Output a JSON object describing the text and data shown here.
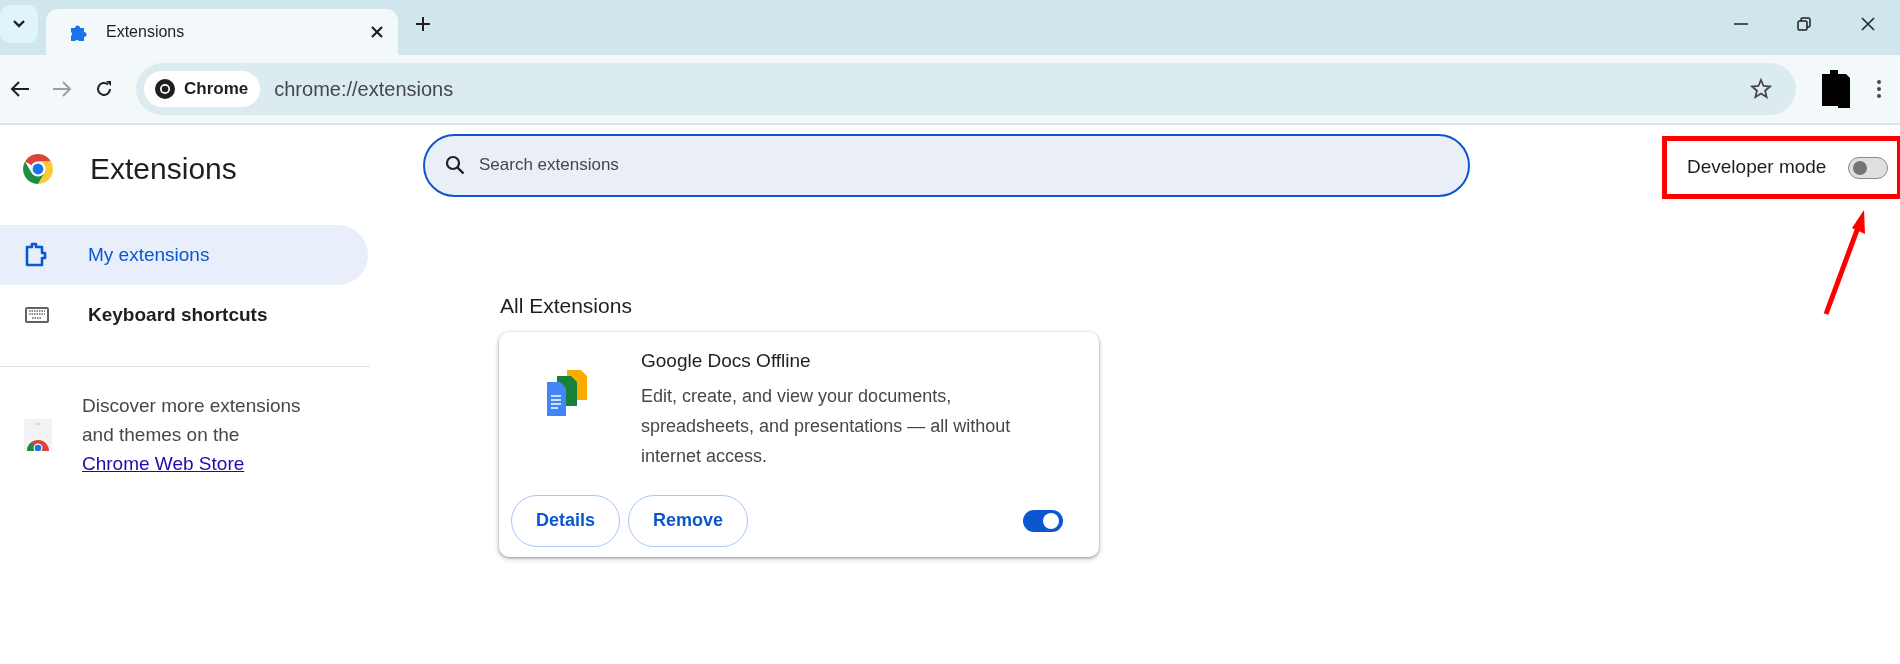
{
  "tabs": [
    {
      "label": "Extensions",
      "selected": true
    }
  ],
  "toolbar": {
    "site_chip": "Chrome",
    "url": "chrome://extensions"
  },
  "header": {
    "title": "Extensions",
    "search": {
      "placeholder": "Search extensions"
    },
    "developer_mode": {
      "label": "Developer mode",
      "on": false
    }
  },
  "sidebar": {
    "items": [
      {
        "label": "My extensions",
        "selected": true,
        "kind": "extensions"
      },
      {
        "label": "Keyboard shortcuts",
        "selected": false,
        "kind": "keyboard"
      }
    ],
    "promo": {
      "text": "Discover more extensions and themes on the ",
      "link": "Chrome Web Store"
    }
  },
  "section_title": "All Extensions",
  "extensions": [
    {
      "name": "Google Docs Offline",
      "description": "Edit, create, and view your documents, spreadsheets, and presentations — all without internet access.",
      "buttons": [
        "Details",
        "Remove"
      ],
      "on": true
    }
  ]
}
